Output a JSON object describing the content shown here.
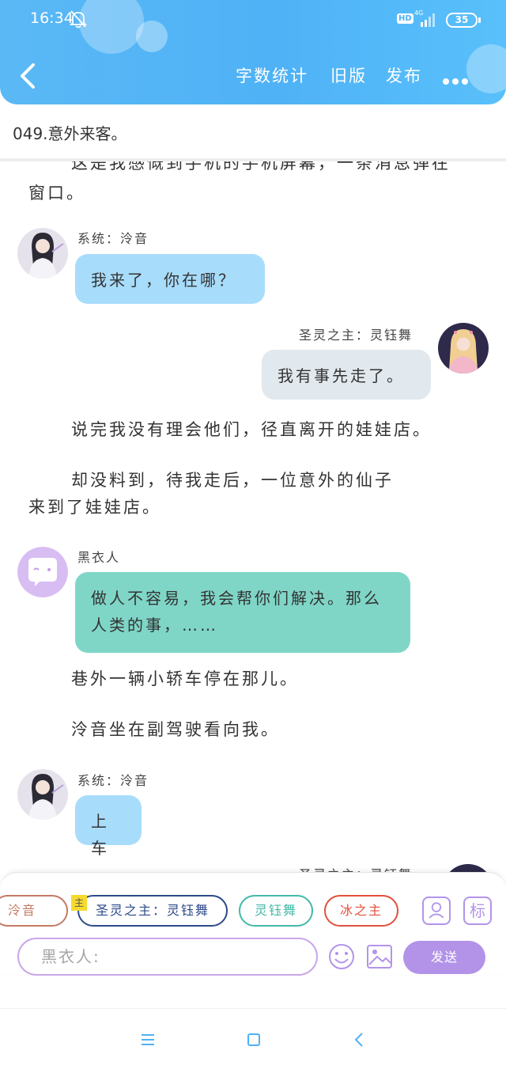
{
  "status_bar": {
    "time": "16:34",
    "hd": "HD",
    "network": "4G",
    "battery": "35"
  },
  "header": {
    "actions": {
      "stats": "字数统计",
      "old_version": "旧版",
      "publish": "发布"
    },
    "accent": "#4fb2f6"
  },
  "chapter": {
    "title": "049.意外来客。"
  },
  "content": {
    "cut_text_line1": "这是我感慨到手机的手机屏幕，一条消息弹在",
    "cut_text_line2": "窗口。",
    "messages": [
      {
        "speaker": "系统：泠音",
        "text": "我来了，你在哪？"
      },
      {
        "speaker": "圣灵之主：灵钰舞",
        "text": "我有事先走了。"
      },
      {
        "narration": "说完我没有理会他们，径直离开的娃娃店。"
      },
      {
        "narration_line1": "却没料到，待我走后，一位意外的仙子",
        "narration_line2": "来到了娃娃店。"
      },
      {
        "speaker": "黑衣人",
        "text_line1": "做人不容易，我会帮你们解决。那么",
        "text_line2": "人类的事，……"
      },
      {
        "narration": "巷外一辆小轿车停在那儿。"
      },
      {
        "narration": "泠音坐在副驾驶看向我。"
      },
      {
        "speaker": "系统：泠音",
        "text": "上车"
      },
      {
        "speaker": "圣灵之主：灵钰舞"
      }
    ]
  },
  "panel": {
    "chips": [
      "泠音",
      "圣灵之主：灵钰舞",
      "灵钰舞",
      "冰之主"
    ],
    "main_tag": "主",
    "mark_label": "标",
    "input_placeholder": "黑衣人:",
    "send_label": "发送",
    "accent": "#b293e8"
  }
}
